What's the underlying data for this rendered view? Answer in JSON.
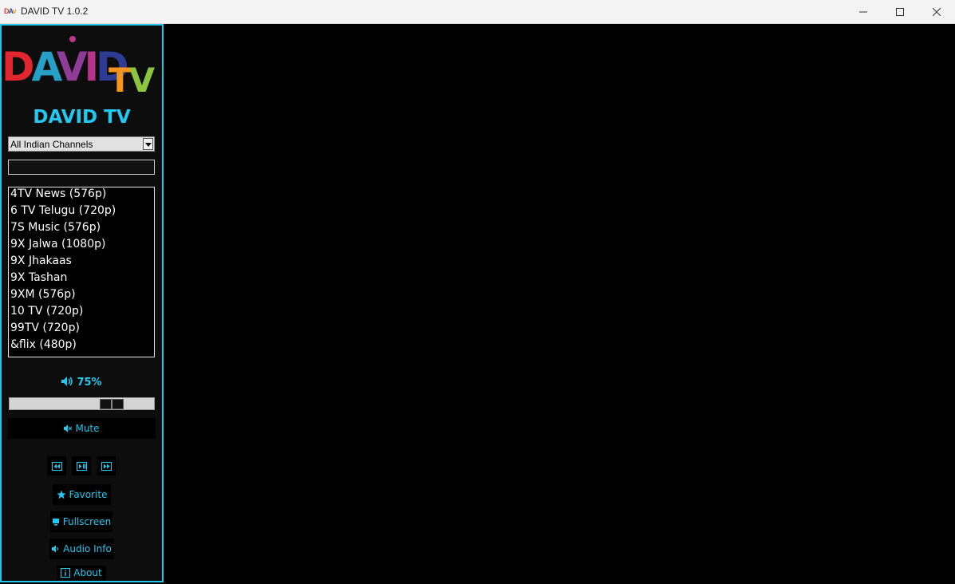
{
  "window": {
    "title": "DAVID TV 1.0.2",
    "icon": "app-logo-icon",
    "controls": [
      "minimize-icon",
      "maximize-icon",
      "close-icon"
    ]
  },
  "sidebar": {
    "logo": {
      "text": "DAVID",
      "suffix": "TV"
    },
    "brand_title": "DAVID TV",
    "category": {
      "selected": "All Indian Channels"
    },
    "search": {
      "value": ""
    },
    "channels": [
      "4TV News (576p)",
      "6 TV Telugu (720p)",
      "7S Music (576p)",
      "9X Jalwa (1080p)",
      "9X Jhakaas",
      "9X Tashan",
      "9XM (576p)",
      "10 TV (720p)",
      "99TV (720p)",
      "&flix (480p)"
    ],
    "volume": {
      "label": "75%",
      "level": 0.75,
      "icon": "speaker-icon"
    },
    "buttons": {
      "mute": "Mute",
      "favorite": "Favorite",
      "fullscreen": "Fullscreen",
      "audio_info": "Audio Info",
      "about": "About"
    }
  },
  "colors": {
    "accent": "#23c8f0",
    "sidebar_bg": "#0d0d0d",
    "video_bg": "#000000"
  }
}
